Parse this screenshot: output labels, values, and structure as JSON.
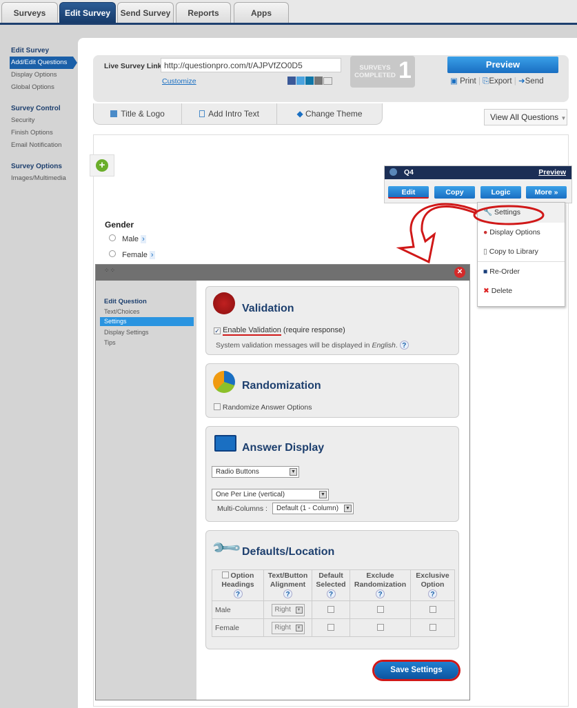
{
  "tabs": [
    "Surveys",
    "Edit Survey",
    "Send Survey",
    "Reports",
    "Apps"
  ],
  "leftnav": {
    "edit_survey": "Edit Survey",
    "add_edit": "Add/Edit Questions",
    "display_options": "Display Options",
    "global_options": "Global Options",
    "survey_control": "Survey Control",
    "security": "Security",
    "finish_options": "Finish Options",
    "email_notification": "Email Notification",
    "survey_options": "Survey Options",
    "images": "Images/Multimedia"
  },
  "header": {
    "link_label": "Live Survey Link",
    "link_value": "http://questionpro.com/t/AJPVfZO0D5",
    "customize": "Customize",
    "surveys_completed": "SURVEYS COMPLETED",
    "completed_count": "1",
    "preview": "Preview",
    "print": "Print",
    "export": "Export",
    "send": "Send"
  },
  "toolbar": {
    "title_logo": "Title & Logo",
    "intro": "Add Intro Text",
    "theme": "Change Theme",
    "view_all": "View All Questions"
  },
  "question": {
    "title": "Gender",
    "choices": [
      "Male",
      "Female"
    ],
    "number": "Q4",
    "preview": "Preview",
    "edit": "Edit",
    "copy": "Copy",
    "logic": "Logic",
    "more": "More »"
  },
  "more_menu": [
    "Settings",
    "Display Options",
    "Copy to Library",
    "Re-Order",
    "Delete"
  ],
  "modal": {
    "nav_heading": "Edit Question",
    "nav": [
      "Text/Choices",
      "Settings",
      "Display Settings",
      "Tips"
    ],
    "validation": {
      "title": "Validation",
      "enable": "Enable Validation",
      "enable_suffix": " (require response)",
      "msg": "System validation messages will be displayed in ",
      "lang": "English",
      "msg_end": ".",
      "checked": true
    },
    "randomization": {
      "title": "Randomization",
      "option": "Randomize Answer Options"
    },
    "answer_display": {
      "title": "Answer Display",
      "type": "Radio Buttons",
      "layout": "One Per Line (vertical)",
      "multi_label": "Multi-Columns :",
      "multi_value": "Default (1 - Column)"
    },
    "defaults": {
      "title": "Defaults/Location",
      "headers": [
        "Option Headings",
        "Text/Button Alignment",
        "Default Selected",
        "Exclude Randomization",
        "Exclusive Option"
      ],
      "rows": [
        {
          "label": "Male",
          "align": "Right"
        },
        {
          "label": "Female",
          "align": "Right"
        }
      ]
    },
    "save": "Save Settings"
  }
}
